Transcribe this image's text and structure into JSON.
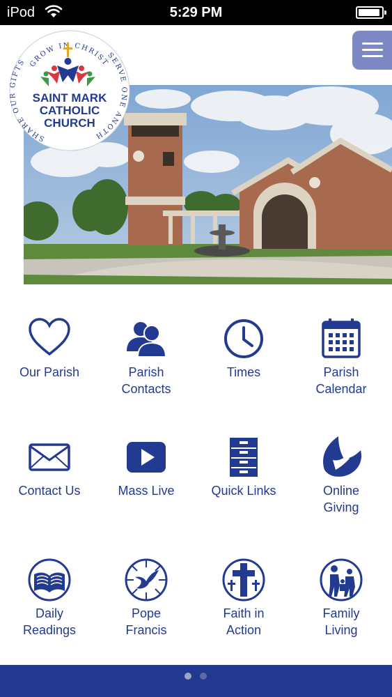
{
  "status_bar": {
    "carrier": "iPod",
    "time": "5:29 PM"
  },
  "logo": {
    "arc_top": "GROW IN CHRIST",
    "arc_right": "SERVE ONE ANOTHER",
    "arc_left": "SHARE OUR GIFTS",
    "name_line1": "SAINT MARK",
    "name_line2": "CATHOLIC",
    "name_line3": "CHURCH"
  },
  "colors": {
    "brand_blue": "#223a8f",
    "menu_button": "#7e89c4",
    "footer": "#23388f"
  },
  "tiles": [
    {
      "line1": "Our Parish",
      "line2": "",
      "icon": "heart-icon"
    },
    {
      "line1": "Parish",
      "line2": "Contacts",
      "icon": "people-icon"
    },
    {
      "line1": "Times",
      "line2": "",
      "icon": "clock-icon"
    },
    {
      "line1": "Parish",
      "line2": "Calendar",
      "icon": "calendar-icon"
    },
    {
      "line1": "Contact Us",
      "line2": "",
      "icon": "envelope-icon"
    },
    {
      "line1": "Mass Live",
      "line2": "",
      "icon": "play-icon"
    },
    {
      "line1": "Quick Links",
      "line2": "",
      "icon": "cabinet-icon"
    },
    {
      "line1": "Online",
      "line2": "Giving",
      "icon": "giving-icon"
    },
    {
      "line1": "Daily",
      "line2": "Readings",
      "icon": "bible-icon"
    },
    {
      "line1": "Pope",
      "line2": "Francis",
      "icon": "dove-icon"
    },
    {
      "line1": "Faith in",
      "line2": "Action",
      "icon": "crosses-icon"
    },
    {
      "line1": "Family",
      "line2": "Living",
      "icon": "family-icon"
    }
  ],
  "pager": {
    "pages": 2,
    "current": 1
  }
}
